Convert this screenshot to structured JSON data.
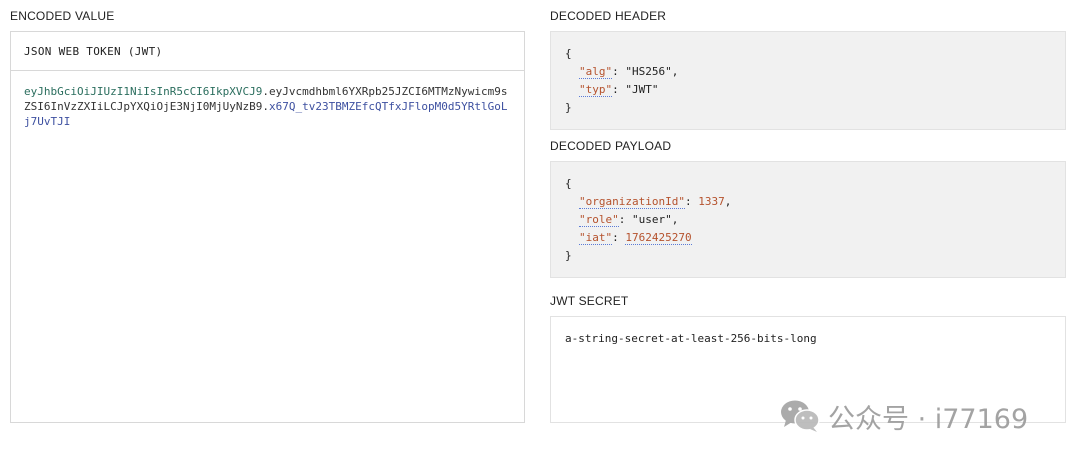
{
  "encoded": {
    "section_label": "ENCODED VALUE",
    "token_type": "JSON WEB TOKEN (JWT)",
    "token_header": "eyJhbGciOiJIUzI1NiIsInR5cCI6IkpXVCJ9",
    "token_payload": "eyJvcmdhbml6YXRpb25JZCI6MTMzNywicm9sZSI6InVzZXIiLCJpYXQiOjE3NjI0MjUyNzB9",
    "token_signature": "x67Q_tv23TBMZEfcQTfxJFlopM0d5YRtlGoLj7UvTJI",
    "dot": "."
  },
  "decoded_header": {
    "section_label": "DECODED HEADER",
    "open_brace": "{",
    "close_brace": "}",
    "fields": [
      {
        "key": "\"alg\"",
        "sep": ": ",
        "value": "\"HS256\"",
        "trail": ","
      },
      {
        "key": "\"typ\"",
        "sep": ": ",
        "value": "\"JWT\"",
        "trail": ""
      }
    ]
  },
  "decoded_payload": {
    "section_label": "DECODED PAYLOAD",
    "open_brace": "{",
    "close_brace": "}",
    "fields": [
      {
        "key": "\"organizationId\"",
        "sep": ": ",
        "value": "1337",
        "trail": ","
      },
      {
        "key": "\"role\"",
        "sep": ": ",
        "value": "\"user\"",
        "trail": ","
      },
      {
        "key": "\"iat\"",
        "sep": ": ",
        "value": "1762425270",
        "trail": ""
      }
    ]
  },
  "secret": {
    "section_label": "JWT SECRET",
    "value": "a-string-secret-at-least-256-bits-long"
  },
  "watermark": {
    "text": "公众号 · i77169",
    "icon": "wechat-icon"
  }
}
